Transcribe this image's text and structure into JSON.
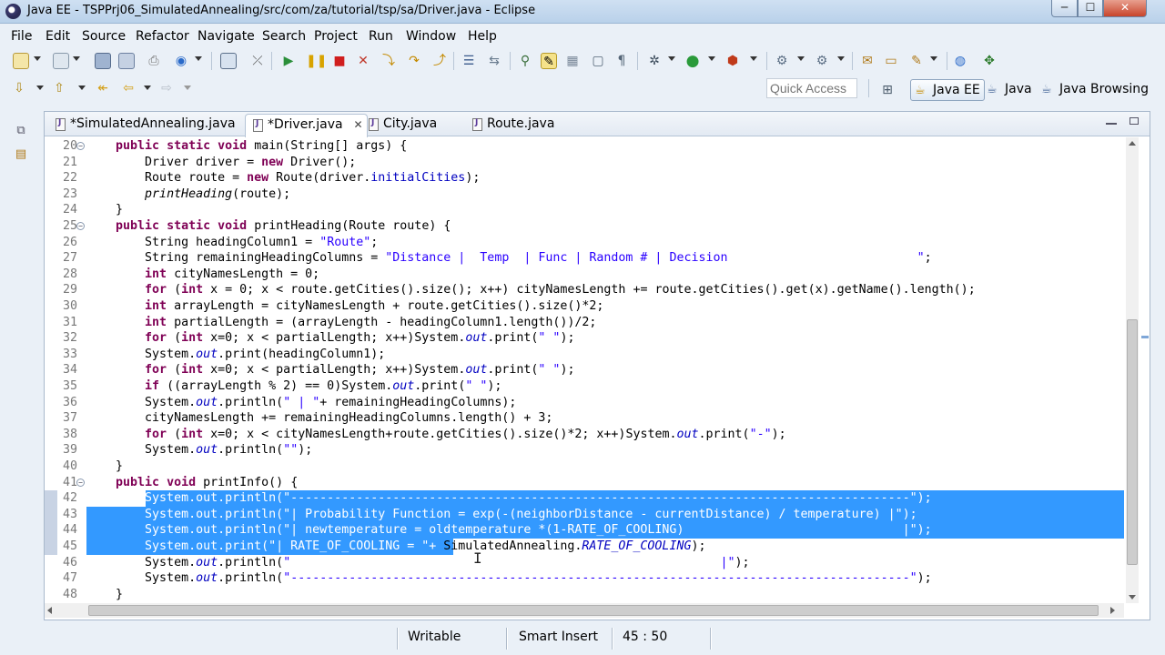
{
  "window": {
    "title": "Java EE - TSPPrj06_SimulatedAnnealing/src/com/za/tutorial/tsp/sa/Driver.java - Eclipse",
    "minimize": "─",
    "maximize": "☐",
    "close": "✕"
  },
  "menu": [
    "File",
    "Edit",
    "Source",
    "Refactor",
    "Navigate",
    "Search",
    "Project",
    "Run",
    "Window",
    "Help"
  ],
  "quick_access": {
    "placeholder": "Quick Access"
  },
  "perspectives": [
    {
      "label": "Java EE",
      "active": true,
      "icon": "java-ee-perspective-icon"
    },
    {
      "label": "Java",
      "active": false,
      "icon": "java-perspective-icon"
    },
    {
      "label": "Java Browsing",
      "active": false,
      "icon": "java-browsing-perspective-icon"
    }
  ],
  "tabs": [
    {
      "label": "*SimulatedAnnealing.java",
      "active": false
    },
    {
      "label": "*Driver.java",
      "active": true,
      "close": "✕"
    },
    {
      "label": "City.java",
      "active": false
    },
    {
      "label": "Route.java",
      "active": false
    }
  ],
  "editor": {
    "first_line": 20,
    "selected_lines": [
      42,
      43,
      44,
      45
    ],
    "lines": [
      {
        "n": "20",
        "fold": "−",
        "code": "    public static void main(String[] args) {"
      },
      {
        "n": "21",
        "code": "        Driver driver = new Driver();"
      },
      {
        "n": "22",
        "code": "        Route route = new Route(driver.initialCities);"
      },
      {
        "n": "23",
        "code": "        printHeading(route);"
      },
      {
        "n": "24",
        "code": "    }"
      },
      {
        "n": "25",
        "fold": "−",
        "code": "    public static void printHeading(Route route) {"
      },
      {
        "n": "26",
        "code": "        String headingColumn1 = \"Route\";"
      },
      {
        "n": "27",
        "code": "        String remainingHeadingColumns = \"Distance |  Temp  | Func | Random # | Decision                          \";"
      },
      {
        "n": "28",
        "code": "        int cityNamesLength = 0;"
      },
      {
        "n": "29",
        "code": "        for (int x = 0; x < route.getCities().size(); x++) cityNamesLength += route.getCities().get(x).getName().length();"
      },
      {
        "n": "30",
        "code": "        int arrayLength = cityNamesLength + route.getCities().size()*2;"
      },
      {
        "n": "31",
        "code": "        int partialLength = (arrayLength - headingColumn1.length())/2;"
      },
      {
        "n": "32",
        "code": "        for (int x=0; x < partialLength; x++)System.out.print(\" \");"
      },
      {
        "n": "33",
        "code": "        System.out.print(headingColumn1);"
      },
      {
        "n": "34",
        "code": "        for (int x=0; x < partialLength; x++)System.out.print(\" \");"
      },
      {
        "n": "35",
        "code": "        if ((arrayLength % 2) == 0)System.out.print(\" \");"
      },
      {
        "n": "36",
        "code": "        System.out.println(\" | \"+ remainingHeadingColumns);"
      },
      {
        "n": "37",
        "code": "        cityNamesLength += remainingHeadingColumns.length() + 3;"
      },
      {
        "n": "38",
        "code": "        for (int x=0; x < cityNamesLength+route.getCities().size()*2; x++)System.out.print(\"-\");"
      },
      {
        "n": "39",
        "code": "        System.out.println(\"\");"
      },
      {
        "n": "40",
        "code": "    }"
      },
      {
        "n": "41",
        "fold": "−",
        "code": "    public void printInfo() {"
      },
      {
        "n": "42",
        "code": "        System.out.println(\"-------------------------------------------------------------------------------------\");"
      },
      {
        "n": "43",
        "code": "        System.out.println(\"| Probability Function = exp(-(neighborDistance - currentDistance) / temperature) |\");"
      },
      {
        "n": "44",
        "code": "        System.out.println(\"| newtemperature = oldtemperature *(1-RATE_OF_COOLING)                              |\");"
      },
      {
        "n": "45",
        "code": "        System.out.print(\"| RATE_OF_COOLING = \"+ SimulatedAnnealing.RATE_OF_COOLING);"
      },
      {
        "n": "46",
        "code": "        System.out.println(\"                                                           |\");"
      },
      {
        "n": "47",
        "code": "        System.out.println(\"-------------------------------------------------------------------------------------\");"
      },
      {
        "n": "48",
        "code": "    }"
      }
    ]
  },
  "status": {
    "writable": "Writable",
    "insert_mode": "Smart Insert",
    "position": "45 : 50"
  },
  "colors": {
    "selection": "#3399ff",
    "keyword": "#7f0055",
    "string": "#2a00ff",
    "field": "#0000c0"
  }
}
